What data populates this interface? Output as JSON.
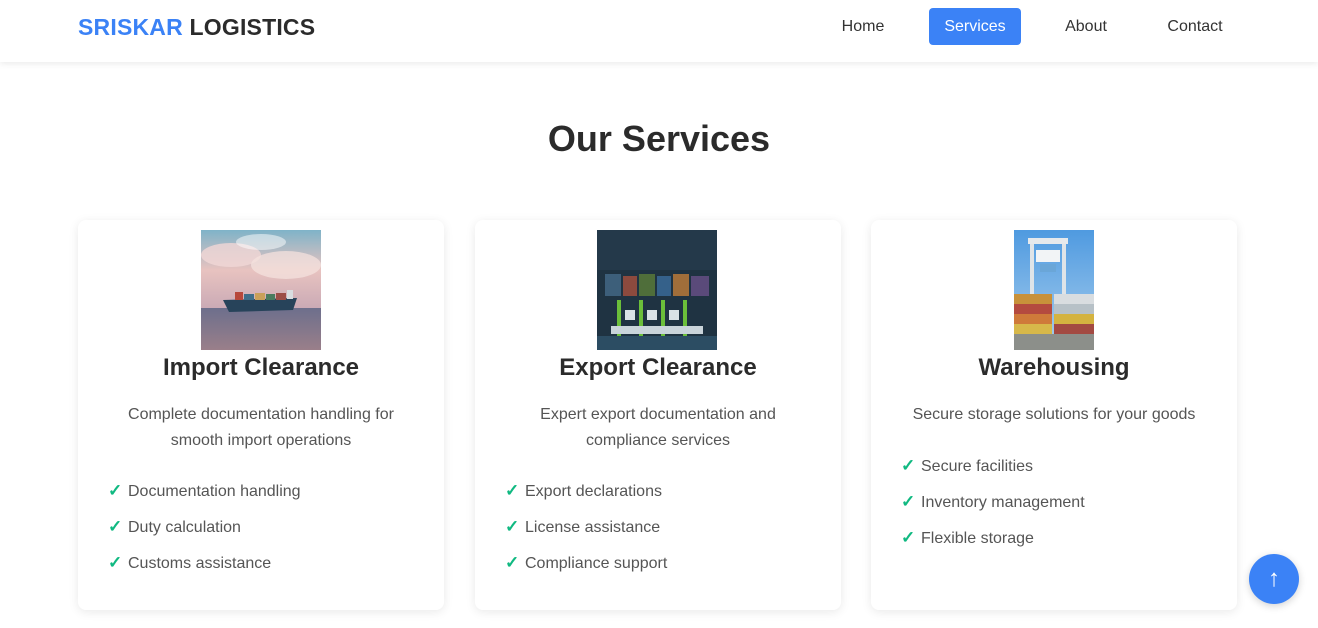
{
  "header": {
    "logo_brand": "SRISKAR",
    "logo_rest": " LOGISTICS",
    "nav": [
      {
        "label": "Home",
        "active": false
      },
      {
        "label": "Services",
        "active": true
      },
      {
        "label": "About",
        "active": false
      },
      {
        "label": "Contact",
        "active": false
      }
    ]
  },
  "main": {
    "title": "Our Services",
    "cards": [
      {
        "title": "Import Clearance",
        "description": "Complete documentation handling for smooth import operations",
        "features": [
          "Documentation handling",
          "Duty calculation",
          "Customs assistance"
        ]
      },
      {
        "title": "Export Clearance",
        "description": "Expert export documentation and compliance services",
        "features": [
          "Export declarations",
          "License assistance",
          "Compliance support"
        ]
      },
      {
        "title": "Warehousing",
        "description": "Secure storage solutions for your goods",
        "features": [
          "Secure facilities",
          "Inventory management",
          "Flexible storage"
        ]
      }
    ]
  },
  "scroll_top": {
    "icon": "arrow-up-icon",
    "glyph": "↑"
  },
  "colors": {
    "accent": "#3b82f6",
    "check": "#10b981",
    "text": "#333333"
  }
}
